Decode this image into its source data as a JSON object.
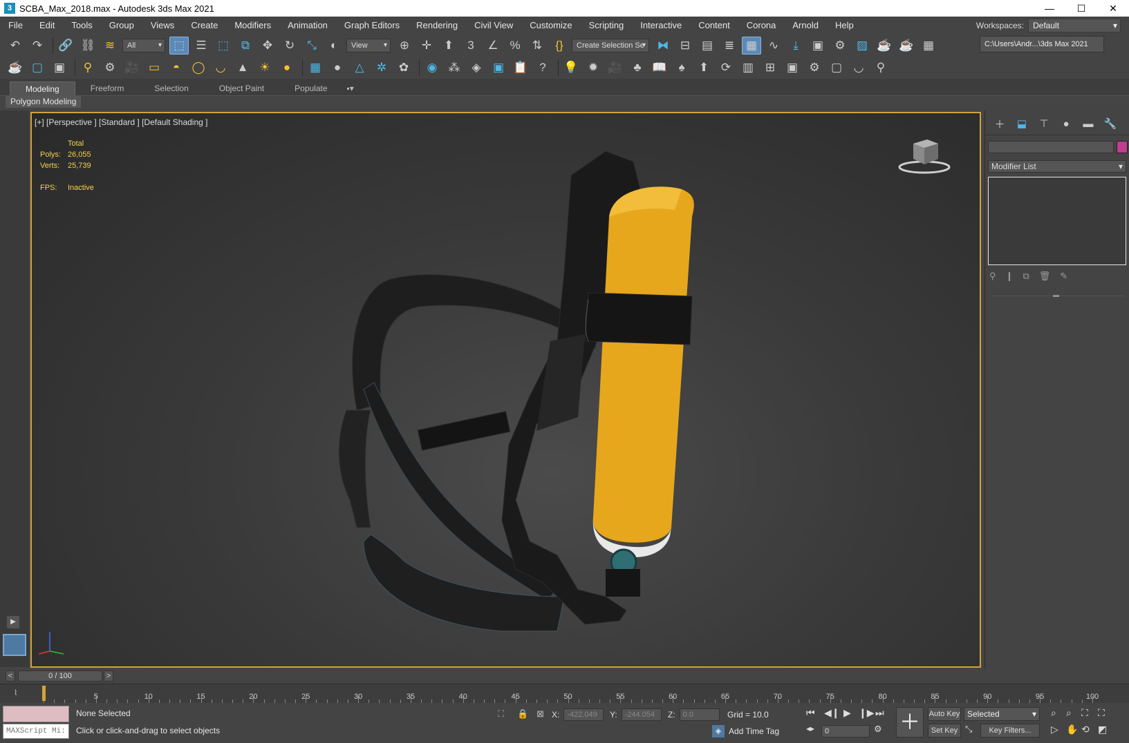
{
  "window": {
    "title": "SCBA_Max_2018.max - Autodesk 3ds Max 2021",
    "app_icon": "3"
  },
  "menu": [
    "File",
    "Edit",
    "Tools",
    "Group",
    "Views",
    "Create",
    "Modifiers",
    "Animation",
    "Graph Editors",
    "Rendering",
    "Civil View",
    "Customize",
    "Scripting",
    "Interactive",
    "Content",
    "Corona",
    "Arnold",
    "Help"
  ],
  "workspace": {
    "label": "Workspaces:",
    "value": "Default"
  },
  "toolbar": {
    "filter": "All",
    "refcoord": "View",
    "selection_set": "Create Selection Se",
    "project_path": "C:\\Users\\Andr...\\3ds Max 2021"
  },
  "ribbon": {
    "tabs": [
      "Modeling",
      "Freeform",
      "Selection",
      "Object Paint",
      "Populate"
    ],
    "active": "Modeling",
    "panel": "Polygon Modeling"
  },
  "viewport": {
    "label": "[+] [Perspective ] [Standard ] [Default Shading ]",
    "stats": {
      "header": "Total",
      "polys_label": "Polys:",
      "polys": "26,055",
      "verts_label": "Verts:",
      "verts": "25,739",
      "fps_label": "FPS:",
      "fps": "Inactive"
    }
  },
  "command_panel": {
    "modifier_list": "Modifier List",
    "color": "#c03d8e"
  },
  "timeline": {
    "frame": "0 / 100",
    "ticks": [
      "5",
      "10",
      "15",
      "20",
      "25",
      "30",
      "35",
      "40",
      "45",
      "50",
      "55",
      "60",
      "65",
      "70",
      "75",
      "80",
      "85",
      "90",
      "95",
      "100"
    ]
  },
  "status": {
    "maxscript": "MAXScript Mi:",
    "selection": "None Selected",
    "prompt": "Click or click-and-drag to select objects",
    "x_label": "X:",
    "x": "-422.049",
    "y_label": "Y:",
    "y": "-244.054",
    "z_label": "Z:",
    "z": "0.0",
    "grid": "Grid = 10.0",
    "add_time_tag": "Add Time Tag",
    "auto_key": "Auto Key",
    "set_key": "Set Key",
    "selected": "Selected",
    "key_filters": "Key Filters...",
    "current_frame": "0"
  },
  "colors": {
    "viewport_border": "#d2a43c",
    "stats_text": "#f4d34c",
    "tank": "#e7a71c"
  }
}
